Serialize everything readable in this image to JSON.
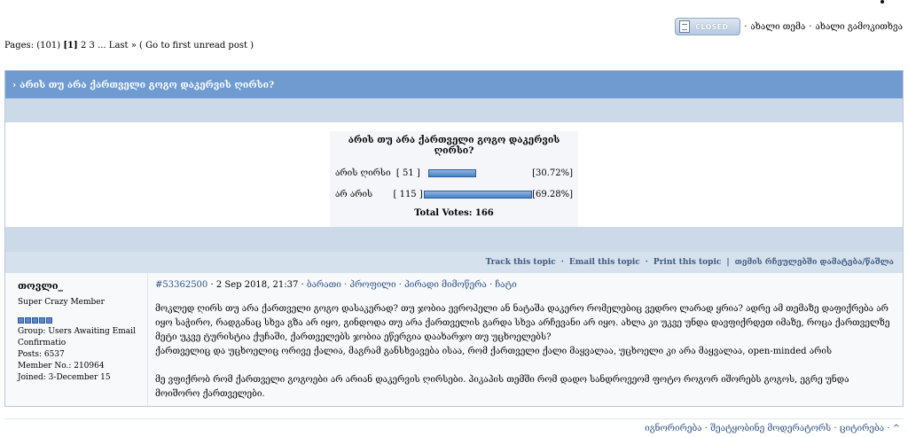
{
  "header": {
    "closed_label": "CLOSED",
    "new_topic": "ახალი თემა",
    "new_poll": "ახალი გამოკითხვა",
    "sep": "·"
  },
  "pagination": {
    "prefix": "Pages:",
    "count": "(101)",
    "current": "[1]",
    "p2": "2",
    "p3": "3",
    "ellipsis": "...",
    "last": "Last »",
    "first_unread": "( Go to first unread post )"
  },
  "topic": {
    "title_arrow": "›",
    "title": "არის თუ არა ქართველი გოგო დაკერვის ღირსი?"
  },
  "poll": {
    "question": "არის თუ არა ქართველი გოგო დაკერვის ღირსი?",
    "options": [
      {
        "label": "არის ღირსი",
        "votes": "[ 51 ]",
        "percent": 30.72,
        "percent_label": "[30.72%]"
      },
      {
        "label": "არ არის",
        "votes": "[ 115 ]",
        "percent": 69.28,
        "percent_label": "[69.28%]"
      }
    ],
    "total": "Total Votes: 166"
  },
  "tools": {
    "track": "Track this topic",
    "email": "Email this topic",
    "print": "Print this topic",
    "dot": "·",
    "bar": "|",
    "add_fav": "თემის რჩეულებში დამატება/წაშლა"
  },
  "post": {
    "author": {
      "name": "თოვლი_",
      "rank": "Super Crazy Member",
      "group": "Group: Users Awaiting Email Confirmatio",
      "posts": "Posts: 6537",
      "member_no": "Member No.: 210964",
      "joined": "Joined: 3-December 15"
    },
    "meta": {
      "id": "#53362500",
      "date": " · 2 Sep 2018, 21:37 · ",
      "links": "ბარათი · პროფილი · პირადი მიმოწერა · ჩატი"
    },
    "paragraph1": "მოკლედ ღირს თუ არა ქართველი გოგო დასაკერად? თუ ჯობია ევროპელი ან ნატაშა დაკერო რომელებიც ვედრო ლარად ყრია? ადრე ამ თემაზე დაფიქრება არ იყო საჭირო, რადგანაც სხვა გზა არ იყო, გინდოდა თუ არა ქართველის გარდა სხვა არჩევანი არ იყო. ახლა კი უკვე უნდა დავფიქრდეთ იმაზე, როცა ქართველზე მეტი უკვე ტურისტია ქუჩაში, ქართველებს ჯობია ეწერგია დაახარჯო თუ უცხოელებს?",
    "paragraph2": "ქართველიც და უცხოელიც ორივე ქალია, მაგრამ განსხვავება ისაა, რომ ქართველი ქალი მაყვალაა, უცხოელი კი არა მაყვალაა, open-minded არის",
    "paragraph3": "მე ვფიქრობ რომ ქართველი გოგოები არ არიან დაკერვის ღირსები. პიკაპის თემში რომ დადო სანდროვეომ ფოტო როგორ იშორებს გოგოს, ეგრე უნდა მოიშორო ქართველები."
  },
  "footer": {
    "actions": "იგნორირება · შეატყობინე მოდერატორს · ციტირება · ^"
  },
  "colors": {
    "title_bar": "#6f9bd0",
    "band": "#ccd9e8",
    "bar_fill": "#4a7fc4"
  }
}
